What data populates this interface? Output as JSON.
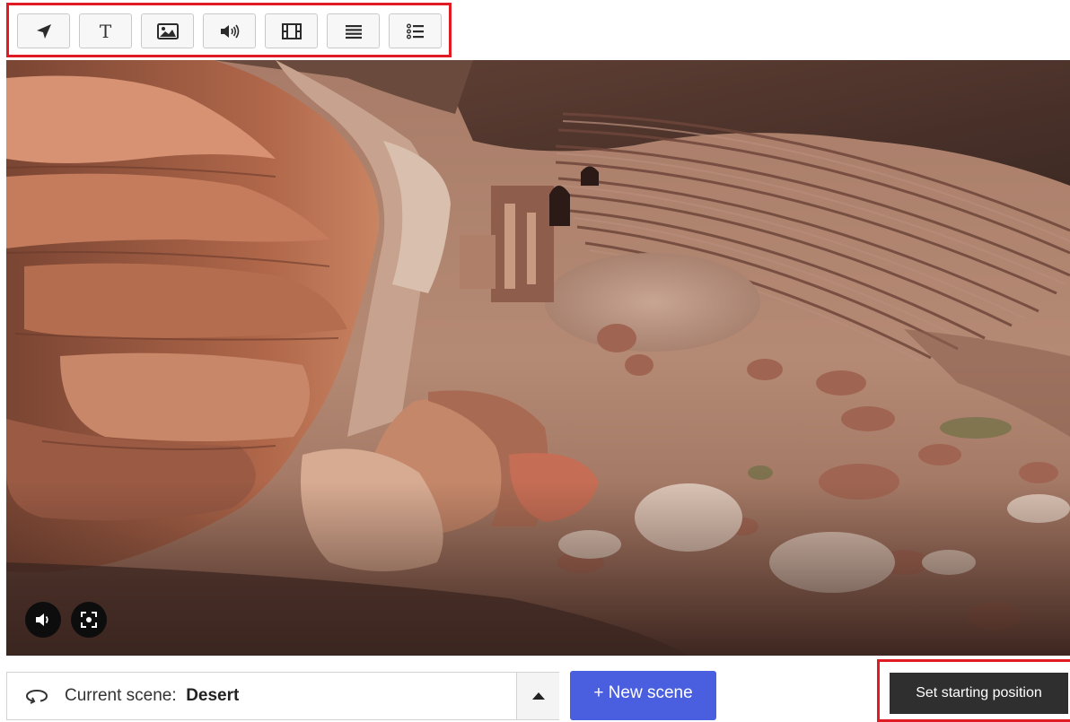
{
  "toolbar": {
    "buttons": [
      {
        "name": "navigation-arrow",
        "icon": "arrow-icon"
      },
      {
        "name": "text",
        "icon": "text-icon",
        "glyph": "T"
      },
      {
        "name": "image",
        "icon": "image-icon"
      },
      {
        "name": "audio",
        "icon": "speaker-icon"
      },
      {
        "name": "video",
        "icon": "film-icon"
      },
      {
        "name": "list",
        "icon": "list-icon"
      },
      {
        "name": "bullet-list",
        "icon": "bulleted-list-icon"
      }
    ]
  },
  "viewer": {
    "controls": [
      {
        "name": "mute",
        "icon": "speaker-icon"
      },
      {
        "name": "fullscreen",
        "icon": "fullscreen-icon"
      }
    ]
  },
  "scene_selector": {
    "prefix": "Current scene:",
    "name": "Desert",
    "icon": "loop-arrow-icon",
    "toggle_icon": "caret-up-icon"
  },
  "new_scene_label": "+ New scene",
  "set_start_label": "Set starting position",
  "colors": {
    "highlight": "#e01b24",
    "primary": "#4a5fe0",
    "dark_button": "#2f2f2f"
  }
}
